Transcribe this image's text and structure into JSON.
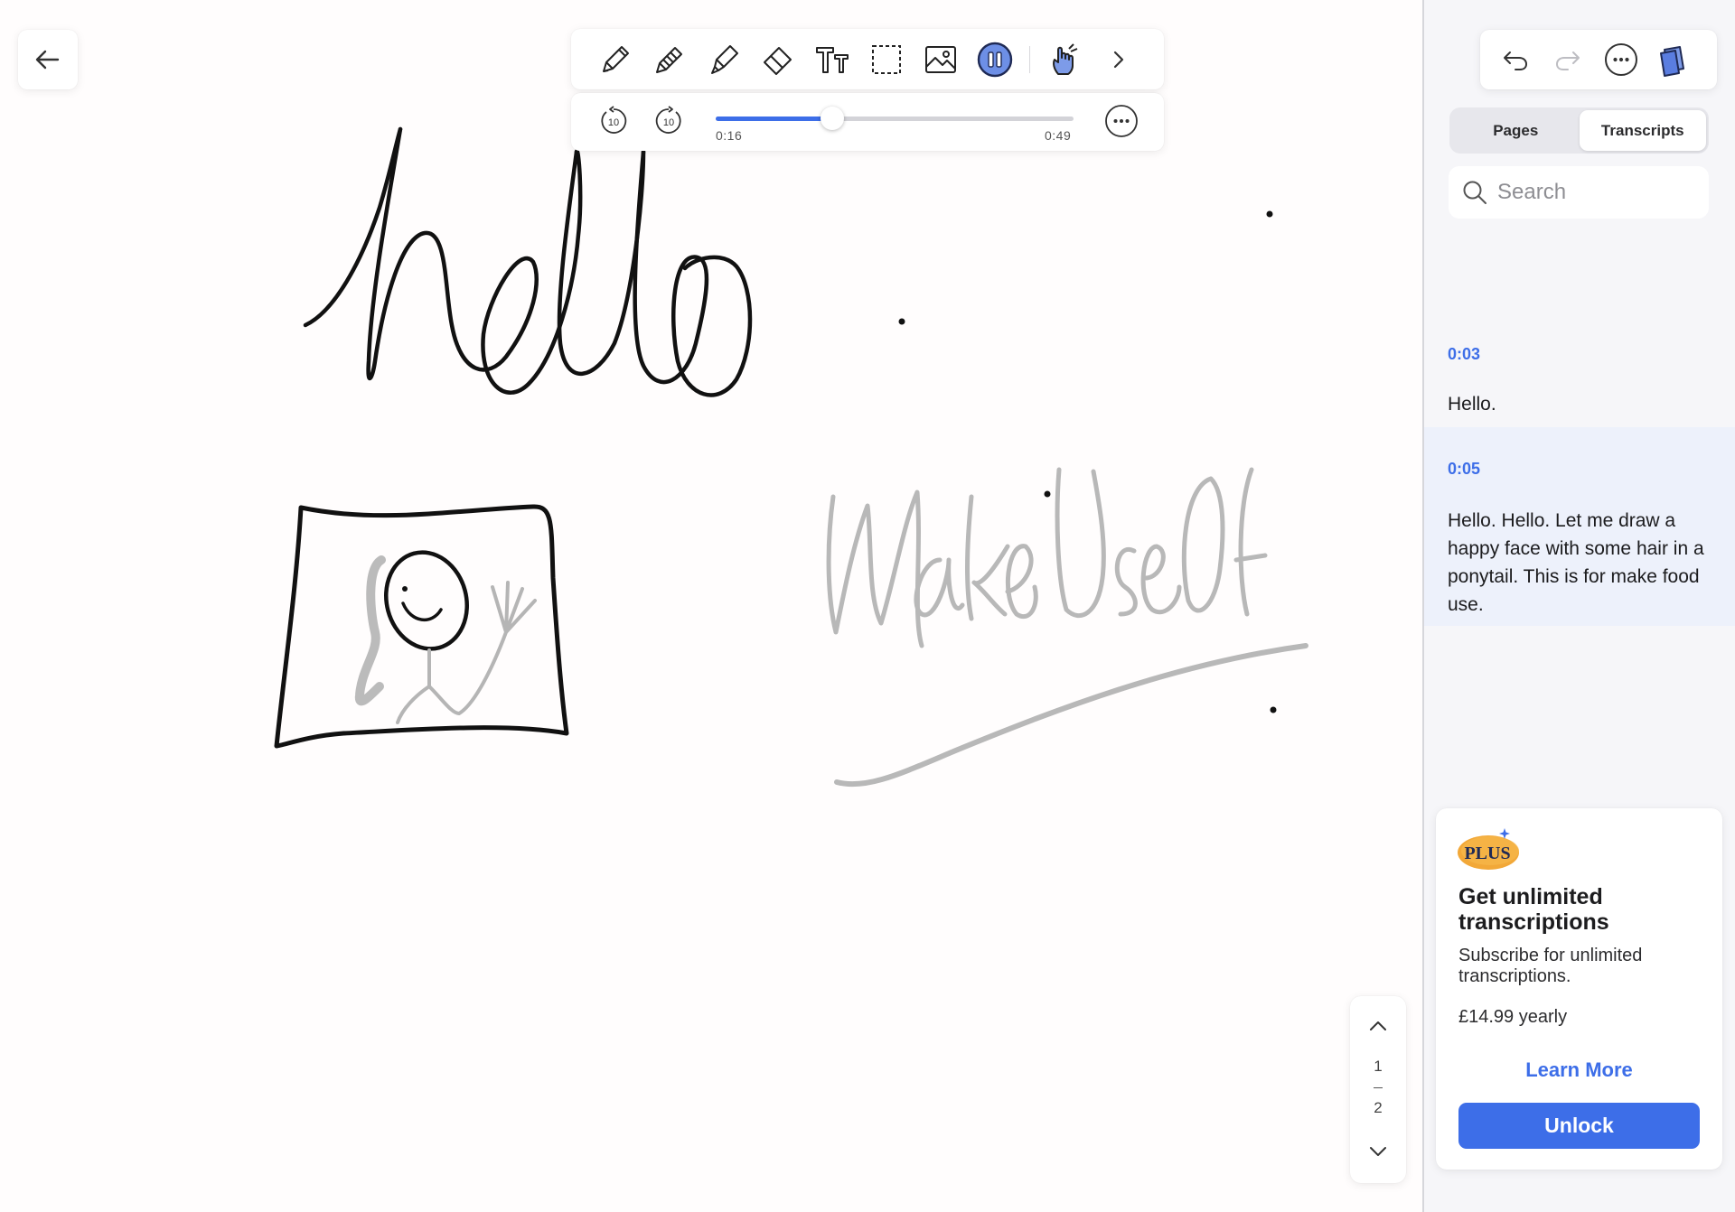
{
  "toolbar": {
    "tools": [
      "pencil-icon",
      "pen-icon",
      "highlighter-icon",
      "eraser-icon",
      "text-tool-icon",
      "lasso-select-icon",
      "image-icon",
      "pause-icon",
      "hand-touch-icon"
    ],
    "more": "chevron-right-icon"
  },
  "playback": {
    "skip_back_label": "10",
    "skip_forward_label": "10",
    "current_time": "0:16",
    "total_time": "0:49",
    "progress": 0.327,
    "accent": "#3d6ee8"
  },
  "canvas": {
    "handwriting": [
      "hello",
      "Make Use Of"
    ]
  },
  "page_nav": {
    "current": "1",
    "total": "2"
  },
  "sidebar": {
    "toolbar": [
      "undo-icon",
      "redo-icon",
      "more-icon",
      "pages-icon"
    ],
    "tabs": [
      {
        "label": "Pages",
        "active": false
      },
      {
        "label": "Transcripts",
        "active": true
      }
    ],
    "search": {
      "placeholder": "Search",
      "value": ""
    },
    "transcripts": [
      {
        "time": "0:03",
        "text": "Hello."
      },
      {
        "time": "0:05",
        "text": "Hello. Hello. Let me draw a happy face with some hair in a ponytail. This is for make food use."
      }
    ],
    "plus": {
      "badge": "PLUS",
      "title": "Get unlimited transcriptions",
      "subtitle": "Subscribe for unlimited transcriptions.",
      "price": "£14.99 yearly",
      "learn_more": "Learn More",
      "unlock": "Unlock"
    }
  }
}
